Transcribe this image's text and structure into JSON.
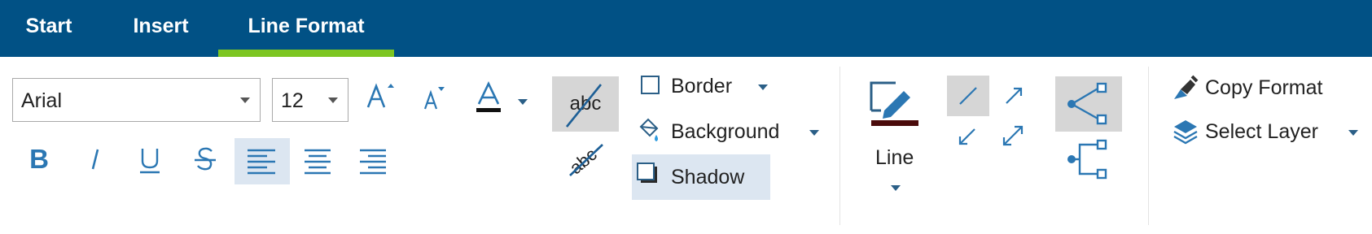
{
  "tabs": [
    {
      "label": "Start"
    },
    {
      "label": "Insert"
    },
    {
      "label": "Line Format"
    }
  ],
  "font": {
    "family": "Arial",
    "size": "12"
  },
  "effects": {
    "border": "Border",
    "background": "Background",
    "shadow": "Shadow"
  },
  "line": {
    "label": "Line"
  },
  "format": {
    "copy": "Copy Format",
    "select_layer": "Select Layer"
  },
  "sample_text": "abc",
  "colors": {
    "tab_bar": "#015185",
    "active_tab_underline": "#7dc622",
    "icon_blue": "#2b77b3",
    "selected_bg": "#dce6f1",
    "pressed_bg": "#d6d6d6"
  }
}
